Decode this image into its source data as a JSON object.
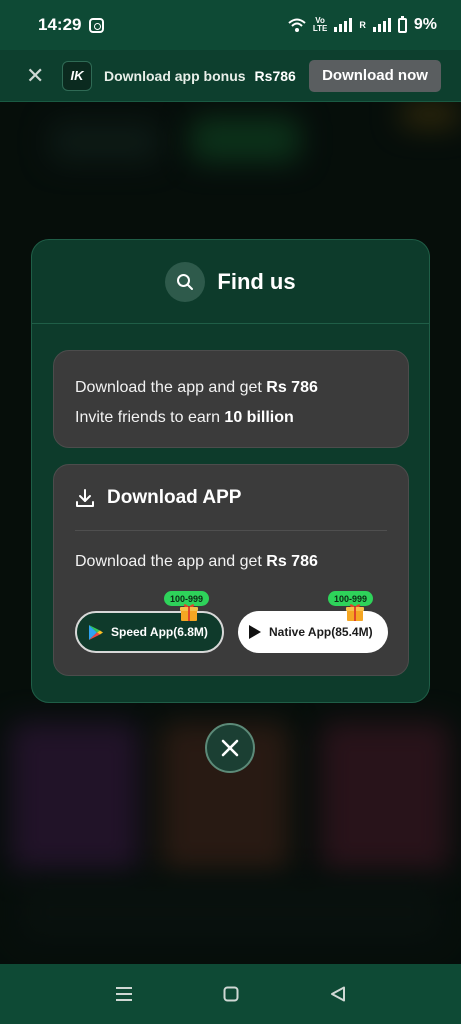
{
  "status_bar": {
    "time": "14:29",
    "volte_line1": "Vo",
    "volte_line2": "LTE",
    "roaming": "R",
    "battery": "9%"
  },
  "promo": {
    "logo": "IK",
    "text": "Download app bonus",
    "amount": "Rs786",
    "button_label": "Download now"
  },
  "modal": {
    "title": "Find us",
    "info": {
      "line1_prefix": "Download the app and get",
      "line1_value": "Rs 786",
      "line2_prefix": "Invite friends to earn",
      "line2_value": "10 billion"
    },
    "download": {
      "title": "Download APP",
      "text_prefix": "Download the app and get",
      "text_value": "Rs 786",
      "speed_app": {
        "label": "Speed App(6.8M)",
        "badge": "100-999"
      },
      "native_app": {
        "label": "Native App(85.4M)",
        "badge": "100-999"
      }
    }
  },
  "icons": [
    "instagram-icon",
    "wifi-icon",
    "signal-icon",
    "battery-icon",
    "close-icon",
    "search-icon",
    "download-icon",
    "google-play-icon",
    "play-icon",
    "gift-icon",
    "menu-icon",
    "home-icon",
    "back-icon"
  ],
  "colors": {
    "brand_green": "#0e4a35",
    "modal_bg": "#0d3b2b",
    "card_bg": "#3b3b3b",
    "badge_green": "#2ed35a",
    "promo_button": "#5a5e60"
  }
}
